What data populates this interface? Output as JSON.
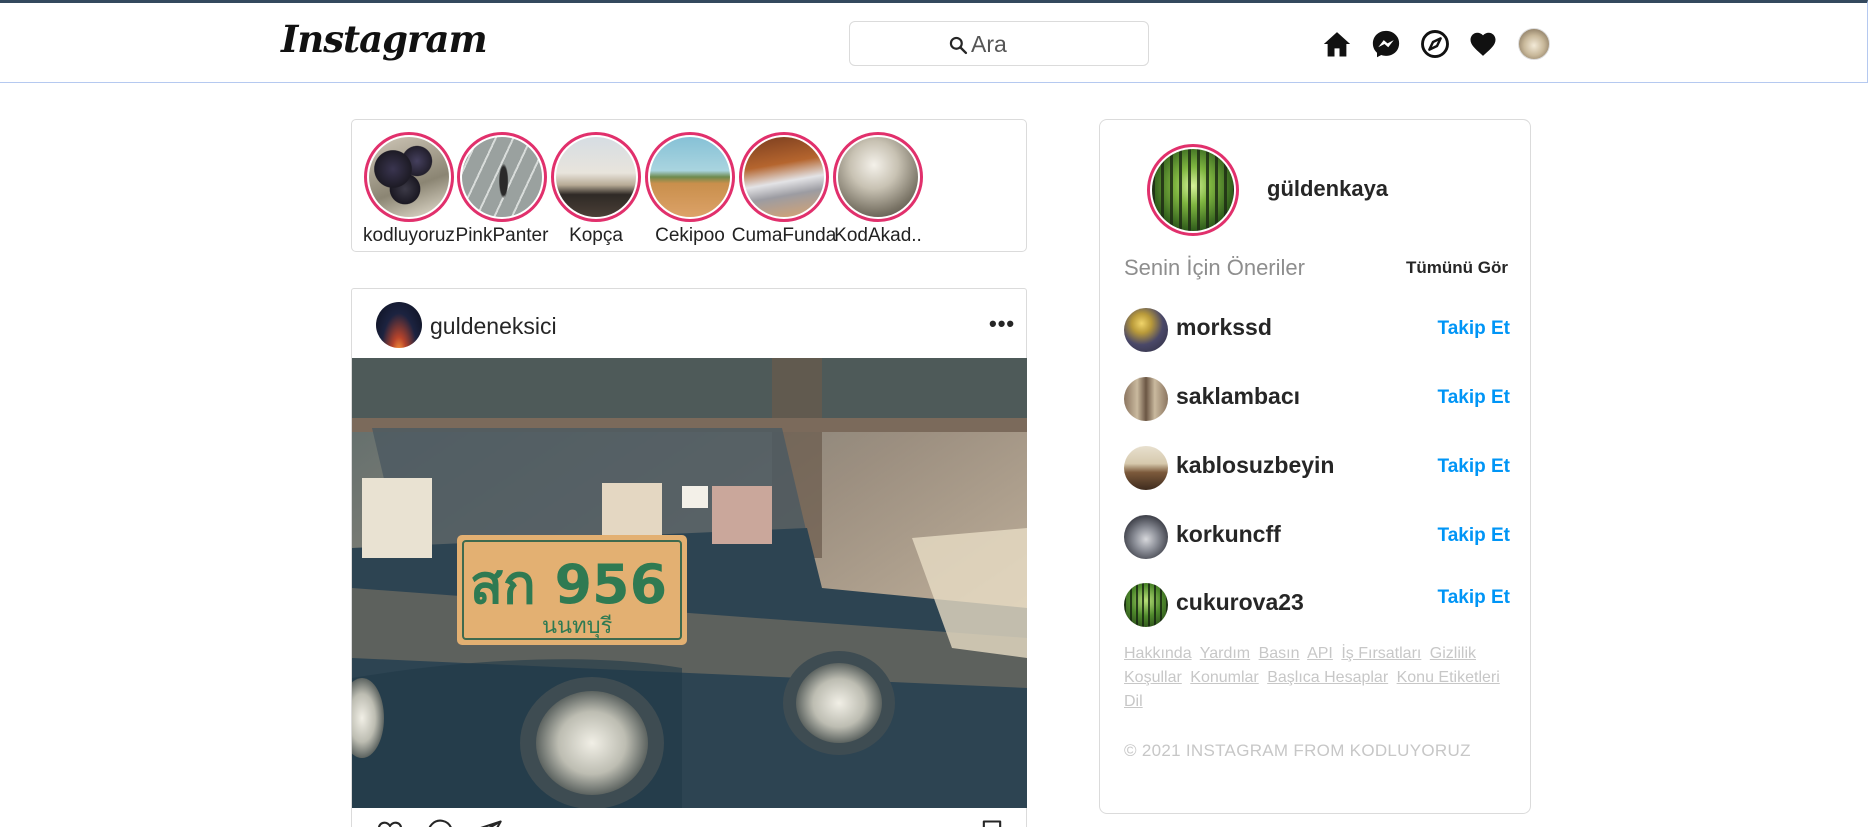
{
  "header": {
    "logo": "Instagram",
    "search_placeholder": "Ara",
    "icons": [
      "home-icon",
      "messenger-icon",
      "explore-compass-icon",
      "heart-icon",
      "profile-avatar"
    ]
  },
  "stories": [
    {
      "name": "kodluyoruz"
    },
    {
      "name": "PinkPanter"
    },
    {
      "name": "Kopça"
    },
    {
      "name": "Cekipoo"
    },
    {
      "name": "CumaFunda"
    },
    {
      "name": "KodAkad.."
    }
  ],
  "post": {
    "username": "guldeneksici",
    "more": "•••",
    "plate_text": "สก 956",
    "plate_subtext": "นนทบุรี",
    "actions": [
      "heart-icon",
      "comment-icon",
      "share-icon",
      "bookmark-icon"
    ]
  },
  "sidebar": {
    "username": "güldenkaya",
    "suggestions_title": "Senin İçin Öneriler",
    "see_all": "Tümünü Gör",
    "suggestions": [
      {
        "name": "morkssd",
        "action": "Takip Et"
      },
      {
        "name": "saklambacı",
        "action": "Takip Et"
      },
      {
        "name": "kablosuzbeyin",
        "action": "Takip Et"
      },
      {
        "name": "korkuncff",
        "action": "Takip Et"
      },
      {
        "name": "cukurova23",
        "action": "Takip Et"
      }
    ],
    "footer_links": [
      "Hakkında",
      "Yardım",
      "Basın",
      "API",
      "İş Fırsatları",
      "Gizlilik",
      "Koşullar",
      "Konumlar",
      "Başlıca Hesaplar",
      "Konu Etiketleri",
      "Dil"
    ],
    "copyright": "© 2021 INSTAGRAM FROM KODLUYORUZ"
  },
  "colors": {
    "story_ring": "#e1306c",
    "follow_blue": "#0095f6",
    "muted_text": "#8e8e8e",
    "footer_text": "#c7c7c7"
  }
}
